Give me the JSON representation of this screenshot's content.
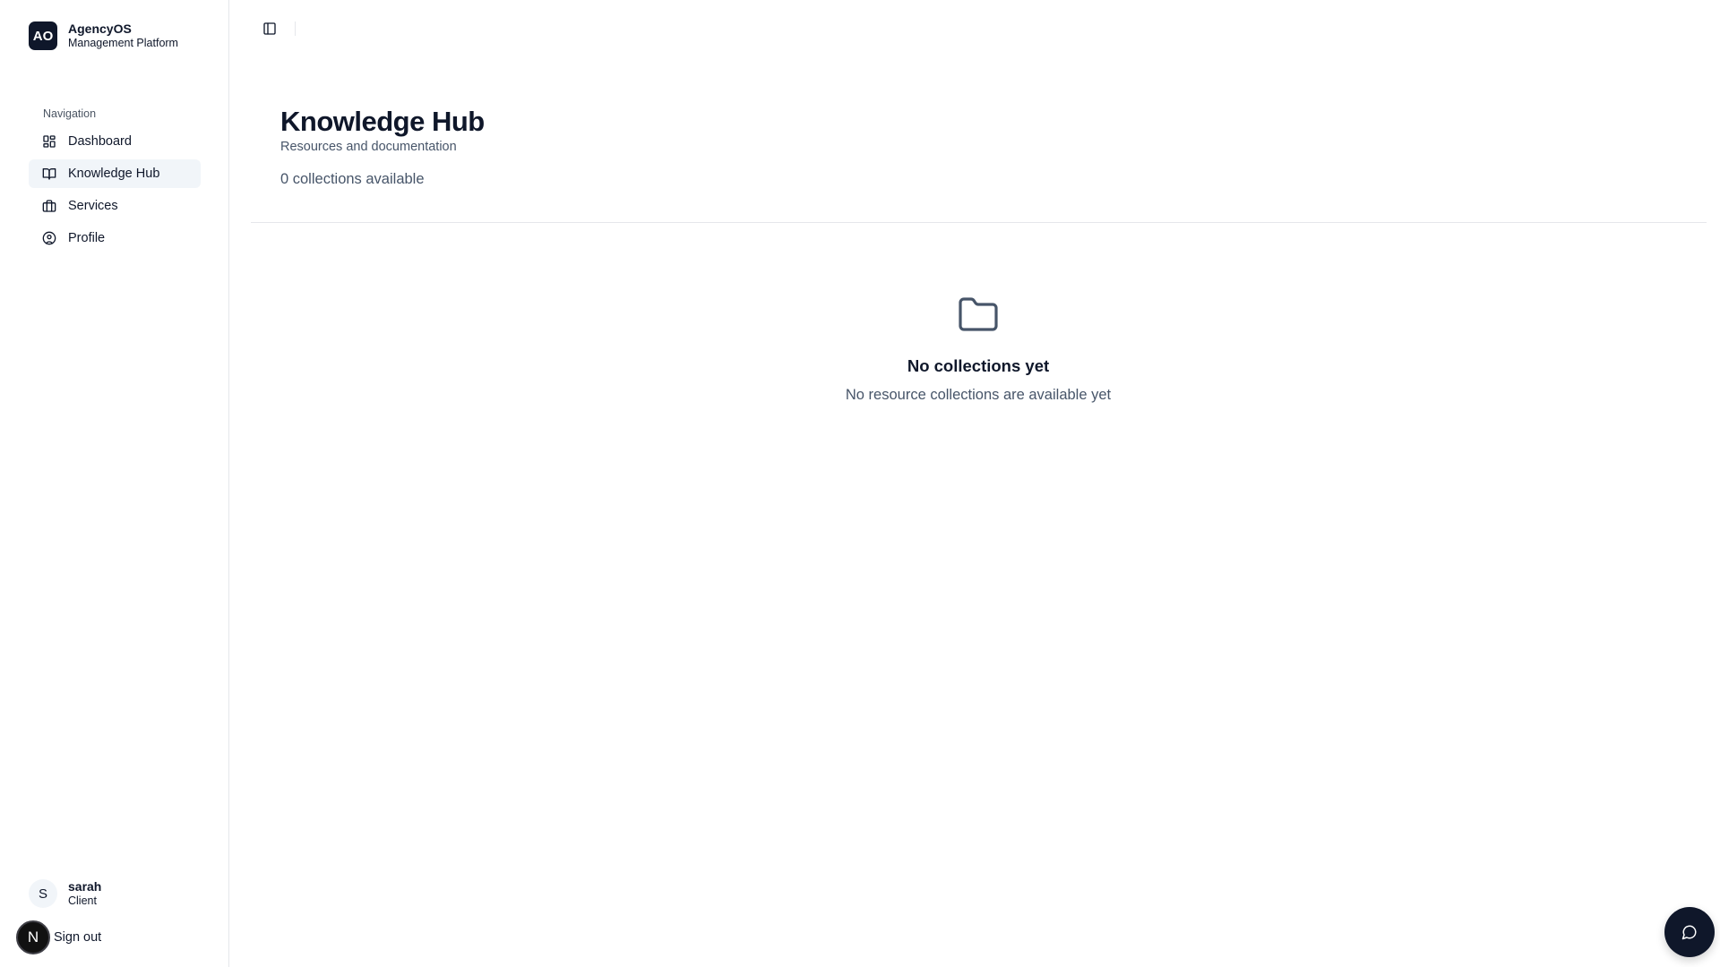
{
  "brand": {
    "logo_text": "AO",
    "name": "AgencyOS",
    "subtitle": "Management Platform"
  },
  "sidebar": {
    "group_label": "Navigation",
    "items": [
      {
        "label": "Dashboard",
        "icon": "dashboard-icon",
        "active": false
      },
      {
        "label": "Knowledge Hub",
        "icon": "book-open-icon",
        "active": true
      },
      {
        "label": "Services",
        "icon": "briefcase-icon",
        "active": false
      },
      {
        "label": "Profile",
        "icon": "user-circle-icon",
        "active": false
      }
    ],
    "user": {
      "initial": "S",
      "name": "sarah",
      "role": "Client"
    },
    "signout": {
      "badge": "N",
      "label": "Sign out"
    }
  },
  "topbar": {
    "toggle_icon": "sidebar-toggle-icon"
  },
  "page": {
    "title": "Knowledge Hub",
    "subtitle": "Resources and documentation",
    "count_text": "0 collections available"
  },
  "empty_state": {
    "icon": "folder-icon",
    "title": "No collections yet",
    "description": "No resource collections are available yet"
  },
  "chat": {
    "icon": "message-circle-icon"
  },
  "colors": {
    "primary": "#0f172a",
    "muted_text": "#475569",
    "active_bg": "#f1f5f9",
    "border": "#e5e7eb"
  }
}
